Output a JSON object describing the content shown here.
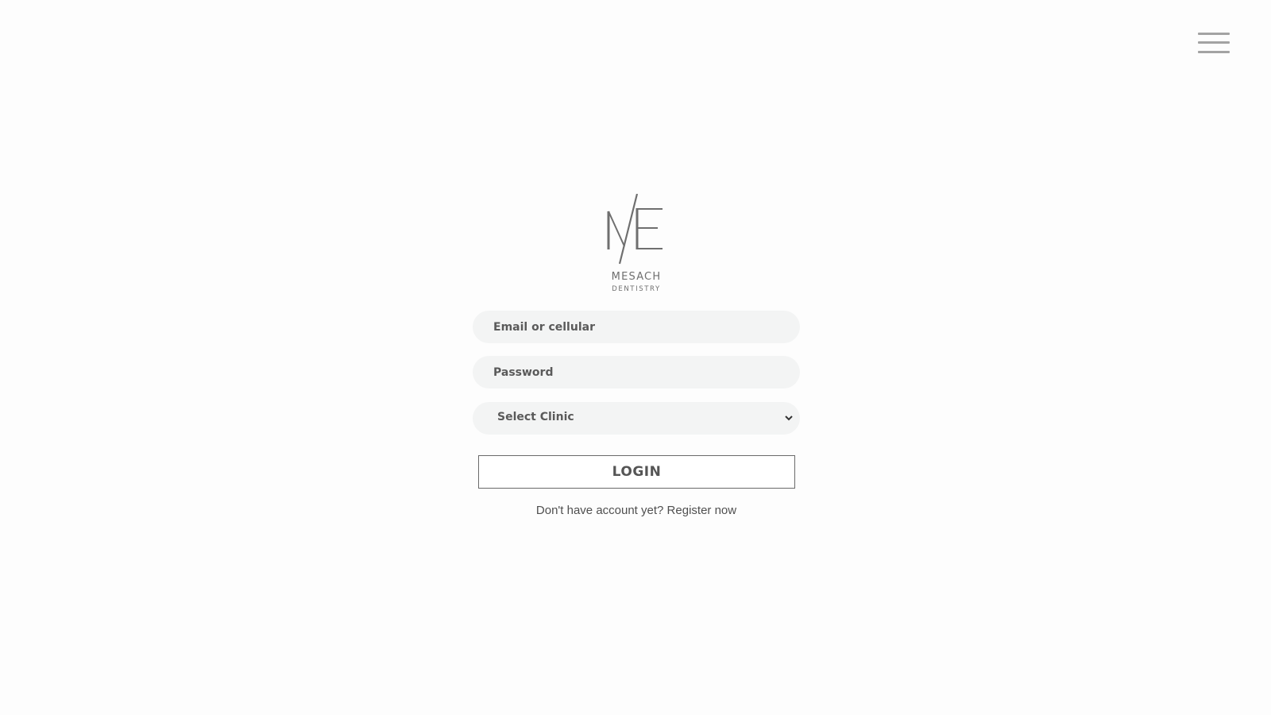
{
  "header": {
    "menu_icon": "hamburger-menu-icon"
  },
  "logo": {
    "monogram": "ME",
    "name": "MESACH",
    "subtitle": "DENTISTRY"
  },
  "login_form": {
    "email": {
      "placeholder": "Email or cellular",
      "value": ""
    },
    "password": {
      "placeholder": "Password",
      "value": ""
    },
    "clinic_select": {
      "selected": "Select Clinic",
      "icon": "chevron-down-icon"
    },
    "submit_label": "LOGIN"
  },
  "register": {
    "prompt": "Don't have account yet?",
    "link_label": "Register now"
  },
  "colors": {
    "background": "#fdfdfd",
    "field_background": "#f3f4f4",
    "text": "#5a5a5a",
    "logo": "#6f6f6f"
  }
}
